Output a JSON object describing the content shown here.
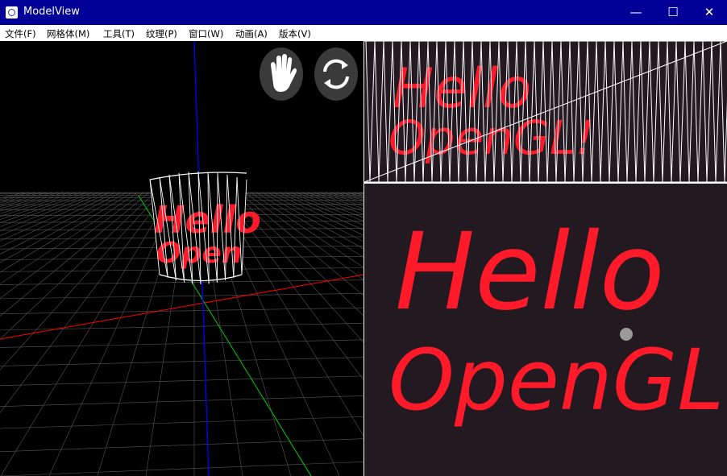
{
  "window": {
    "title": "ModelView",
    "minimize_symbol": "—",
    "maximize_symbol": "☐",
    "close_symbol": "✕"
  },
  "menu": [
    {
      "label": "文件(F)"
    },
    {
      "label": "网格体(M)"
    },
    {
      "label": "工具(T)"
    },
    {
      "label": "纹理(P)"
    },
    {
      "label": "窗口(W)"
    },
    {
      "label": "动画(A)"
    },
    {
      "label": "版本(V)"
    }
  ],
  "toolbar": {
    "pan_icon": "hand-icon",
    "rotate_icon": "rotate-icon"
  },
  "viewport": {
    "model_text_line1": "Hello",
    "model_text_line2": "Open",
    "axis_colors": {
      "x": "#ff0000",
      "y": "#00cc00",
      "z": "#0000ff"
    }
  },
  "texture": {
    "line1": "Hello",
    "line2": "OpenGL!",
    "ink_color": "#ff1a2a",
    "background": "#231920"
  }
}
